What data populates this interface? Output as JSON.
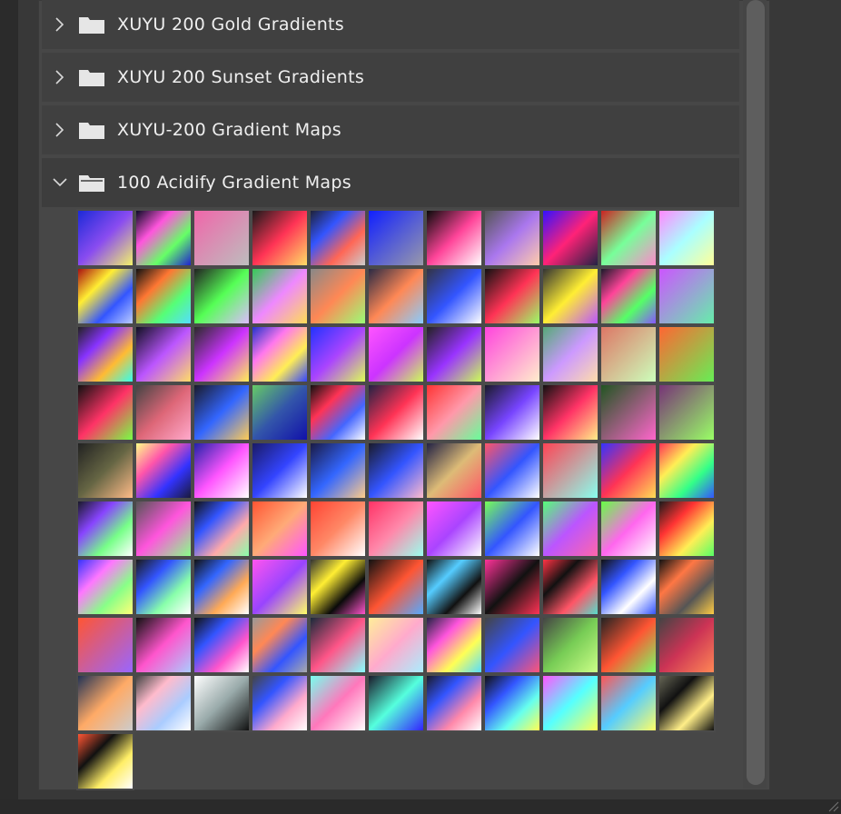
{
  "folders": [
    {
      "name": "XUYU 200 Gold Gradients",
      "expanded": false
    },
    {
      "name": "XUYU 200 Sunset Gradients",
      "expanded": false
    },
    {
      "name": "XUYU-200 Gradient Maps",
      "expanded": false
    },
    {
      "name": "100 Acidify Gradient Maps",
      "expanded": true
    }
  ],
  "icons": {
    "collapsed": "chevron-right-icon",
    "expanded": "chevron-down-icon",
    "folder": "folder-icon",
    "folder_open": "folder-open-icon"
  },
  "swatches": [
    [
      "#1c2ad8",
      "#8a4cf0",
      "#f3f36a"
    ],
    [
      "#0c0c26",
      "#ff55dd",
      "#66ff66",
      "#2020d0"
    ],
    [
      "#f066aa",
      "#bdbdbd"
    ],
    [
      "#1a1a1a",
      "#ff3355",
      "#ffdd66"
    ],
    [
      "#1e2238",
      "#3355ff",
      "#ff6655",
      "#cccccc"
    ],
    [
      "#1020ff",
      "#9999aa"
    ],
    [
      "#0a0a0a",
      "#ff4499",
      "#ffffff"
    ],
    [
      "#555555",
      "#aa77ee",
      "#ffccaa"
    ],
    [
      "#3311ff",
      "#ff2277",
      "#222244"
    ],
    [
      "#cc2222",
      "#77ff99",
      "#ff88cc"
    ],
    [
      "#ff88ff",
      "#aaffff",
      "#ffff99"
    ],
    [
      "#aa1111",
      "#ffee33",
      "#3355ff",
      "#bbccff"
    ],
    [
      "#111111",
      "#ff7733",
      "#55ff77",
      "#55ddff"
    ],
    [
      "#222222",
      "#55ff55",
      "#ddbbff"
    ],
    [
      "#33cc55",
      "#ee88ff",
      "#ffdd55"
    ],
    [
      "#888888",
      "#ff8855",
      "#99ff77"
    ],
    [
      "#2a2a44",
      "#ff8855",
      "#88ccff"
    ],
    [
      "#333344",
      "#3355ff",
      "#ffffff"
    ],
    [
      "#111111",
      "#ff3355",
      "#99ff66"
    ],
    [
      "#333333",
      "#ffee33",
      "#bb55ff"
    ],
    [
      "#1a1a2a",
      "#ff4499",
      "#55ff66",
      "#8855ff"
    ],
    [
      "#cc55ff",
      "#66eeaa"
    ],
    [
      "#222222",
      "#8833ff",
      "#ffbb33",
      "#33ffee"
    ],
    [
      "#111122",
      "#bb55ff",
      "#ffdd66"
    ],
    [
      "#2a2a2a",
      "#cc33ff",
      "#ffee55"
    ],
    [
      "#2233cc",
      "#ff77ee",
      "#ffee55",
      "#3344ff"
    ],
    [
      "#2233ff",
      "#aa44ff",
      "#ddff55"
    ],
    [
      "#ff55ff",
      "#cc33ff",
      "#ccff55"
    ],
    [
      "#222222",
      "#9933ff",
      "#ccff55"
    ],
    [
      "#ff44dd",
      "#ffeecc"
    ],
    [
      "#55aa77",
      "#cc99ff",
      "#ffddaa"
    ],
    [
      "#dd7766",
      "#ccffbb"
    ],
    [
      "#ff6633",
      "#66ee55"
    ],
    [
      "#111111",
      "#ff3366",
      "#77ff44"
    ],
    [
      "#444444",
      "#dd6677",
      "#ffaacc"
    ],
    [
      "#1a1a2a",
      "#3366ff",
      "#ffcc55"
    ],
    [
      "#66cc66",
      "#3355aa",
      "#1111aa"
    ],
    [
      "#111111",
      "#ff3355",
      "#4466ff",
      "#ffffff"
    ],
    [
      "#222244",
      "#ff3355",
      "#ffffff"
    ],
    [
      "#ff3333",
      "#ff99aa",
      "#66ff99"
    ],
    [
      "#1a1a2a",
      "#7744ff",
      "#ffffff"
    ],
    [
      "#111111",
      "#ff3366",
      "#ffee88"
    ],
    [
      "#225522",
      "#ff66cc"
    ],
    [
      "#773377",
      "#99ff66"
    ],
    [
      "#222222",
      "#666644",
      "#ffbb88"
    ],
    [
      "#ffff88",
      "#ff55aa",
      "#3333ff",
      "#1a1a3a"
    ],
    [
      "#2222aa",
      "#ff55ff",
      "#ffffff"
    ],
    [
      "#1a1a66",
      "#3344ff",
      "#ffffff"
    ],
    [
      "#1a1a44",
      "#3366ff",
      "#ffcc88"
    ],
    [
      "#1a1a2a",
      "#3355ff",
      "#ffbbcc"
    ],
    [
      "#222244",
      "#ddbb77",
      "#ff5566"
    ],
    [
      "#ff5566",
      "#3355ff",
      "#ffffff"
    ],
    [
      "#ff4455",
      "#88ffee"
    ],
    [
      "#3333ff",
      "#ff3355",
      "#ffdd55"
    ],
    [
      "#ff3355",
      "#ffee55",
      "#33ff88",
      "#3355ff"
    ],
    [
      "#1a1a2a",
      "#8844ff",
      "#77ff88",
      "#ffffff"
    ],
    [
      "#555555",
      "#ff55dd",
      "#88ff88"
    ],
    [
      "#111111",
      "#3355ff",
      "#ffaaaa",
      "#88ffaa"
    ],
    [
      "#ff5533",
      "#ffaa77",
      "#ff55ff"
    ],
    [
      "#ff4433",
      "#ff8866",
      "#ffffff"
    ],
    [
      "#ff3366",
      "#ff88aa",
      "#99ffee"
    ],
    [
      "#ff55ff",
      "#aa44ff",
      "#ffffff"
    ],
    [
      "#77ff55",
      "#3355ff",
      "#ffffff"
    ],
    [
      "#55ff77",
      "#bb55ff",
      "#ff66aa"
    ],
    [
      "#66ff44",
      "#ff66ee",
      "#ffffff"
    ],
    [
      "#1a1a1a",
      "#ff3333",
      "#ffee55",
      "#55ff66"
    ],
    [
      "#3333ff",
      "#ff77ff",
      "#88ff88",
      "#ffff77"
    ],
    [
      "#1a1a1a",
      "#3355ff",
      "#88ffaa",
      "#ffffff"
    ],
    [
      "#111111",
      "#3366ff",
      "#ffaa55",
      "#ffffff"
    ],
    [
      "#ff55ee",
      "#9944ff",
      "#ffff66"
    ],
    [
      "#333333",
      "#ffee33",
      "#0a0a0a",
      "#ff55cc"
    ],
    [
      "#111111",
      "#ff5533",
      "#55aaff"
    ],
    [
      "#111111",
      "#55ccff",
      "#111111",
      "#ffffff"
    ],
    [
      "#ff3399",
      "#111111",
      "#ff3355"
    ],
    [
      "#ff3344",
      "#111111",
      "#ff5566",
      "#55ddcc"
    ],
    [
      "#111111",
      "#3355ff",
      "#ffffff",
      "#3355ff"
    ],
    [
      "#111111",
      "#ff7744",
      "#555555",
      "#ffcc44"
    ],
    [
      "#ff5533",
      "#9966ff"
    ],
    [
      "#111111",
      "#ff55cc",
      "#aaccff"
    ],
    [
      "#111111",
      "#3355ff",
      "#ff55cc",
      "#ffffff"
    ],
    [
      "#999999",
      "#ff8855",
      "#3355ff",
      "#aaaaaa"
    ],
    [
      "#1a2a3a",
      "#ff5588",
      "#88ffff"
    ],
    [
      "#ffee99",
      "#ffaacc",
      "#aaeeff"
    ],
    [
      "#222244",
      "#ff55dd",
      "#ffff55",
      "#55ddff"
    ],
    [
      "#444444",
      "#3355ff",
      "#ff5577"
    ],
    [
      "#444444",
      "#77cc55",
      "#ccff88"
    ],
    [
      "#222222",
      "#ff5533",
      "#77ff66"
    ],
    [
      "#444444",
      "#cc3355",
      "#ff8855"
    ],
    [
      "#223355",
      "#ffaa66",
      "#cccccc"
    ],
    [
      "#444444",
      "#ffbbcc",
      "#aaccff",
      "#ffffff"
    ],
    [
      "#ffffff",
      "#99aaaa",
      "#111111"
    ],
    [
      "#444444",
      "#3355ff",
      "#ffaacc",
      "#ffffff"
    ],
    [
      "#77ffee",
      "#ff77bb",
      "#ffffff"
    ],
    [
      "#1a1a2a",
      "#55ffdd",
      "#3322ff"
    ],
    [
      "#1a1a2a",
      "#3355ff",
      "#ff88aa",
      "#ffffff"
    ],
    [
      "#111111",
      "#3355ff",
      "#66ffee",
      "#ffff55"
    ],
    [
      "#ff55ff",
      "#55ffff",
      "#ffff55"
    ],
    [
      "#ff5555",
      "#55ccff",
      "#ffff66"
    ],
    [
      "#666655",
      "#111111",
      "#ffee88",
      "#111111"
    ],
    [
      "#ff5533",
      "#111111",
      "#ffee66",
      "#ffffff"
    ]
  ]
}
